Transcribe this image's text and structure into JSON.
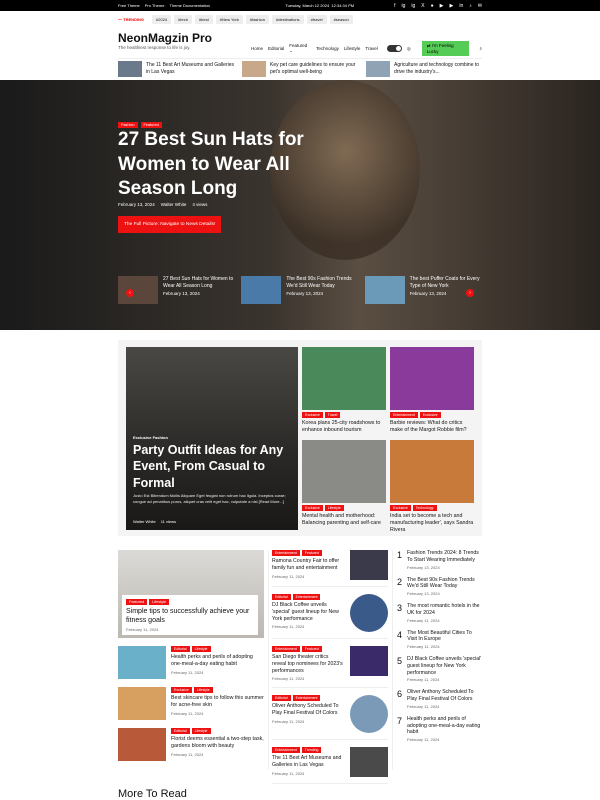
{
  "topbar": {
    "links": [
      "Free Theme",
      "Pro Theme",
      "Theme Documentation"
    ],
    "date": "Tuesday, March 12 2024",
    "time": "12:34:34 PM",
    "social": [
      "f",
      "ig",
      "ig",
      "X",
      "●",
      "▶",
      "▶",
      "in",
      "♪",
      "✉"
    ]
  },
  "trending": {
    "label": "TRENDING",
    "tags": [
      "#2024",
      "#tech",
      "#best",
      "#New York",
      "#fashion",
      "#destinations",
      "#travel",
      "#season"
    ]
  },
  "header": {
    "logo": "NeonMagzin Pro",
    "tagline": "The healthiest response to life is joy.",
    "nav": [
      "Home",
      "Editorial",
      "Featured",
      "Technology",
      "Lifestyle",
      "Travel"
    ],
    "lucky": "I'm Feeling Lucky"
  },
  "strip": [
    {
      "t": "The 11 Best Art Museums and Galleries in Las Vegas",
      "c": "#6a7a8a"
    },
    {
      "t": "Key pet care guidelines to ensure your pet's optimal well-being",
      "c": "#c7a888"
    },
    {
      "t": "Agriculture and technology combine to drive the industry's...",
      "c": "#8fa3b5"
    }
  ],
  "hero": {
    "cats": [
      "Fashion",
      "Featured"
    ],
    "title": "27 Best Sun Hats for Women to Wear All Season Long",
    "date": "February 13, 2024",
    "author": "Walter White",
    "views": "4 views",
    "button": "The Full Picture: Navigate to News Details!",
    "slides": [
      {
        "t": "27 Best Sun Hats for Women to Wear All Season Long",
        "d": "February 13, 2024",
        "c": "#5a463a"
      },
      {
        "t": "The Best 90s Fashion Trends We'd Still Wear Today",
        "d": "February 13, 2024",
        "c": "#4a7aa8"
      },
      {
        "t": "The best Puffer Coats for Every Type of New York",
        "d": "February 13, 2024",
        "c": "#6a9ab8"
      }
    ]
  },
  "featured": {
    "big": {
      "cats": "Exclusive  Fashion",
      "title": "Party Outfit Ideas for Any Event, From Casual to Formal",
      "excerpt": "Justo Est Bibendum Mollis Aliquam Eget feugiat non rutrum hac ligula. Inceptos curae; congue ad penatibus purus, aliquet cras velit eget hac, vulputate a nisl [Read More...]",
      "author": "Walter White",
      "views": "11 views"
    },
    "grid": [
      {
        "cats": [
          "Exclusive",
          "Travel"
        ],
        "t": "Korea plans 25-city roadshows to enhance inbound tourism",
        "c": "#4a8a5a"
      },
      {
        "cats": [
          "Entertainment",
          "Exclusive"
        ],
        "t": "Barbie reviews: What do critics make of the Margot Robbie film?",
        "c": "#8a3a9a"
      },
      {
        "cats": [
          "Exclusive",
          "Lifestyle"
        ],
        "t": "Mental health and motherhood: Balancing parenting and self-care",
        "c": "#8a8a86"
      },
      {
        "cats": [
          "Exclusive",
          "Technology"
        ],
        "t": "India set to become a tech and manufacturing leader', says Sandra Rivera",
        "c": "#c87a3a"
      }
    ]
  },
  "col1": {
    "card": {
      "cats": [
        "Featured",
        "Lifestyle"
      ],
      "t": "Simple tips to successfully achieve your fitness goals",
      "d": "February 11, 2024"
    },
    "rows": [
      {
        "cats": [
          "Editorial",
          "Lifestyle"
        ],
        "t": "Health perks and perils of adopting one-meal-a-day eating habit",
        "d": "February 11, 2024",
        "c": "#6ab0c8"
      },
      {
        "cats": [
          "Exclusive",
          "Lifestyle"
        ],
        "t": "Best skincare tips to follow this summer for acne-free skin",
        "d": "February 11, 2024",
        "c": "#d8a060"
      },
      {
        "cats": [
          "Editorial",
          "Lifestyle"
        ],
        "t": "Florist deems essential a two-step task, gardens bloom with beauty",
        "d": "February 11, 2024",
        "c": "#b85a3a"
      }
    ]
  },
  "col2": [
    {
      "cats": [
        "Entertainment",
        "Featured"
      ],
      "t": "Ramona Country Fair to offer family fun and entertainment",
      "d": "February 11, 2024",
      "c": "#3a3a4a",
      "r": false
    },
    {
      "cats": [
        "Editorial",
        "Entertainment"
      ],
      "t": "DJ Black Coffee unveils 'special' guest lineup for New York performance",
      "d": "February 11, 2024",
      "c": "#3a5a8a",
      "r": true
    },
    {
      "cats": [
        "Entertainment",
        "Featured"
      ],
      "t": "San Diego theater critics reveal top nominees for 2023's performances",
      "d": "February 11, 2024",
      "c": "#3a2a6a",
      "r": false
    },
    {
      "cats": [
        "Editorial",
        "Entertainment"
      ],
      "t": "Oliver Anthony Scheduled To Play Final Festival Of Colors",
      "d": "February 11, 2024",
      "c": "#7a9ab8",
      "r": true
    },
    {
      "cats": [
        "Entertainment",
        "Trending"
      ],
      "t": "The 11 Best Art Museums and Galleries in Las Vegas",
      "d": "February 11, 2024",
      "c": "#4a4a4a",
      "r": false
    }
  ],
  "col3": [
    {
      "n": "1",
      "t": "Fashion Trends 2024: 8 Trends To Start Wearing Immediately",
      "d": "February 13, 2024"
    },
    {
      "n": "2",
      "t": "The Best 90s Fashion Trends We'd Still Wear Today",
      "d": "February 13, 2024"
    },
    {
      "n": "3",
      "t": "The most romantic hotels in the UK for 2024",
      "d": "February 11, 2024"
    },
    {
      "n": "4",
      "t": "The Most Beautiful Cities To Visit In Europe",
      "d": "February 11, 2024"
    },
    {
      "n": "5",
      "t": "DJ Black Coffee unveils 'special' guest lineup for New York performance",
      "d": "February 11, 2024"
    },
    {
      "n": "6",
      "t": "Oliver Anthony Scheduled To Play Final Festival Of Colors",
      "d": "February 11, 2024"
    },
    {
      "n": "7",
      "t": "Health perks and perils of adopting one-meal-a-day eating habit",
      "d": "February 11, 2024"
    }
  ],
  "more": "More To Read"
}
